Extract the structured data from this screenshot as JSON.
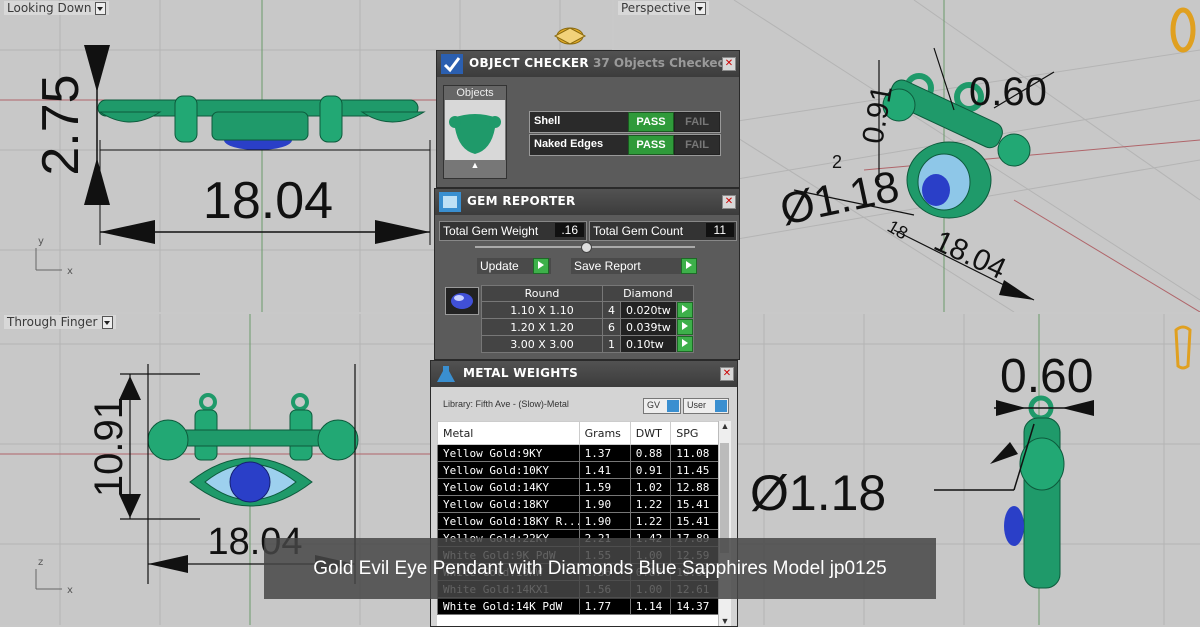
{
  "viewports": {
    "top_left_label": "Looking Down",
    "top_right_label": "Perspective",
    "bottom_left_label": "Through Finger"
  },
  "dimensions": {
    "top_height": "2.75",
    "top_width": "18.04",
    "persp_top": "0.60",
    "persp_side": "0.91",
    "persp_dia": "Ø1.18",
    "persp_len": "18.04",
    "persp_small1": "2",
    "persp_small2": "18",
    "front_height": "10.91",
    "front_width": "18.04",
    "side_top": "0.60",
    "side_dia": "Ø1.18"
  },
  "object_checker": {
    "title": "OBJECT CHECKER",
    "objects_checked": "37 Objects Checked",
    "objects_tab": "Objects",
    "rows": [
      {
        "label": "Shell",
        "pass": "PASS",
        "fail": "FAIL"
      },
      {
        "label": "Naked Edges",
        "pass": "PASS",
        "fail": "FAIL"
      }
    ]
  },
  "gem_reporter": {
    "title": "GEM REPORTER",
    "weight_label": "Total Gem Weight",
    "weight_value": ".16",
    "count_label": "Total Gem Count",
    "count_value": "11",
    "update_label": "Update",
    "save_label": "Save Report",
    "col_shape": "Round",
    "col_type": "Diamond",
    "rows": [
      {
        "size": "1.10 X 1.10",
        "count": "4",
        "tw": "0.020tw"
      },
      {
        "size": "1.20 X 1.20",
        "count": "6",
        "tw": "0.039tw"
      },
      {
        "size": "3.00 X 3.00",
        "count": "1",
        "tw": "0.10tw"
      }
    ]
  },
  "metal_weights": {
    "title": "METAL WEIGHTS",
    "library": "Library: Fifth Ave - (Slow)-Metal",
    "gv_label": "GV",
    "user_label": "User",
    "headers": [
      "Metal",
      "Grams",
      "DWT",
      "SPG"
    ],
    "rows": [
      [
        "Yellow Gold:9KY",
        "1.37",
        "0.88",
        "11.08"
      ],
      [
        "Yellow Gold:10KY",
        "1.41",
        "0.91",
        "11.45"
      ],
      [
        "Yellow Gold:14KY",
        "1.59",
        "1.02",
        "12.88"
      ],
      [
        "Yellow Gold:18KY",
        "1.90",
        "1.22",
        "15.41"
      ],
      [
        "Yellow Gold:18KY R...",
        "1.90",
        "1.22",
        "15.41"
      ],
      [
        "Yellow Gold:22KY",
        "2.21",
        "1.42",
        "17.89"
      ],
      [
        "White Gold:9K PdW",
        "1.55",
        "1.00",
        "12.59"
      ],
      [
        "White Gold:10KW",
        "1.36",
        "0.87",
        "10.99"
      ],
      [
        "White Gold:14KX1",
        "1.56",
        "1.00",
        "12.61"
      ],
      [
        "White Gold:14K PdW",
        "1.77",
        "1.14",
        "14.37"
      ]
    ]
  },
  "caption": "Gold Evil Eye Pendant with Diamonds Blue Sapphires Model jp0125",
  "colors": {
    "model": "#1f9a6a",
    "pass": "#2f9a3a",
    "gem_blue": "#2a3fc8"
  }
}
